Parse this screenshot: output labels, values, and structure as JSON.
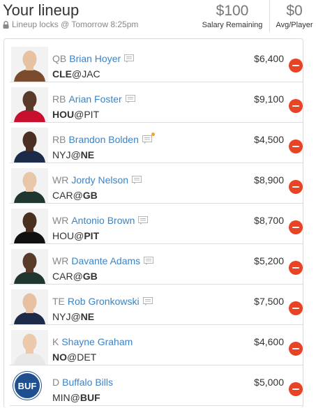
{
  "header": {
    "title": "Your lineup",
    "lock_text": "Lineup locks @ Tomorrow 8:25pm",
    "salary_value": "$100",
    "salary_label": "Salary Remaining",
    "avg_value": "$0",
    "avg_label": "Avg/Player"
  },
  "colors": {
    "link": "#3d83c4",
    "remove": "#e84325",
    "note_alert": "#f5a623"
  },
  "players": [
    {
      "pos": "QB",
      "name": "Brian Hoyer",
      "away": "CLE",
      "home": "JAC",
      "highlight": "away",
      "salary": "$6,400",
      "jersey": "#7a4b2c",
      "skin": "#e6c2a1",
      "note_alert": false,
      "has_note": true
    },
    {
      "pos": "RB",
      "name": "Arian Foster",
      "away": "HOU",
      "home": "PIT",
      "highlight": "away",
      "salary": "$9,100",
      "jersey": "#c8102e",
      "skin": "#5b3a2a",
      "note_alert": false,
      "has_note": true
    },
    {
      "pos": "RB",
      "name": "Brandon Bolden",
      "away": "NYJ",
      "home": "NE",
      "highlight": "home",
      "salary": "$4,500",
      "jersey": "#1c2b4a",
      "skin": "#4a2f22",
      "note_alert": true,
      "has_note": true
    },
    {
      "pos": "WR",
      "name": "Jordy Nelson",
      "away": "CAR",
      "home": "GB",
      "highlight": "home",
      "salary": "$8,900",
      "jersey": "#203731",
      "skin": "#e8c6a6",
      "note_alert": false,
      "has_note": true
    },
    {
      "pos": "WR",
      "name": "Antonio Brown",
      "away": "HOU",
      "home": "PIT",
      "highlight": "home",
      "salary": "$8,700",
      "jersey": "#111111",
      "skin": "#4a2e20",
      "note_alert": false,
      "has_note": true
    },
    {
      "pos": "WR",
      "name": "Davante Adams",
      "away": "CAR",
      "home": "GB",
      "highlight": "home",
      "salary": "$5,200",
      "jersey": "#203731",
      "skin": "#5a3a28",
      "note_alert": false,
      "has_note": true
    },
    {
      "pos": "TE",
      "name": "Rob Gronkowski",
      "away": "NYJ",
      "home": "NE",
      "highlight": "home",
      "salary": "$7,500",
      "jersey": "#1c2b4a",
      "skin": "#e6c0a0",
      "note_alert": false,
      "has_note": true
    },
    {
      "pos": "K",
      "name": "Shayne Graham",
      "away": "NO",
      "home": "DET",
      "highlight": "away",
      "salary": "$4,600",
      "jersey": "#e8e8e8",
      "skin": "#ecc9aa",
      "note_alert": false,
      "has_note": false
    },
    {
      "pos": "D",
      "name": "Buffalo Bills",
      "away": "MIN",
      "home": "BUF",
      "highlight": "home",
      "salary": "$5,000",
      "logo_text": "BUF",
      "is_team": true,
      "has_note": false
    }
  ]
}
